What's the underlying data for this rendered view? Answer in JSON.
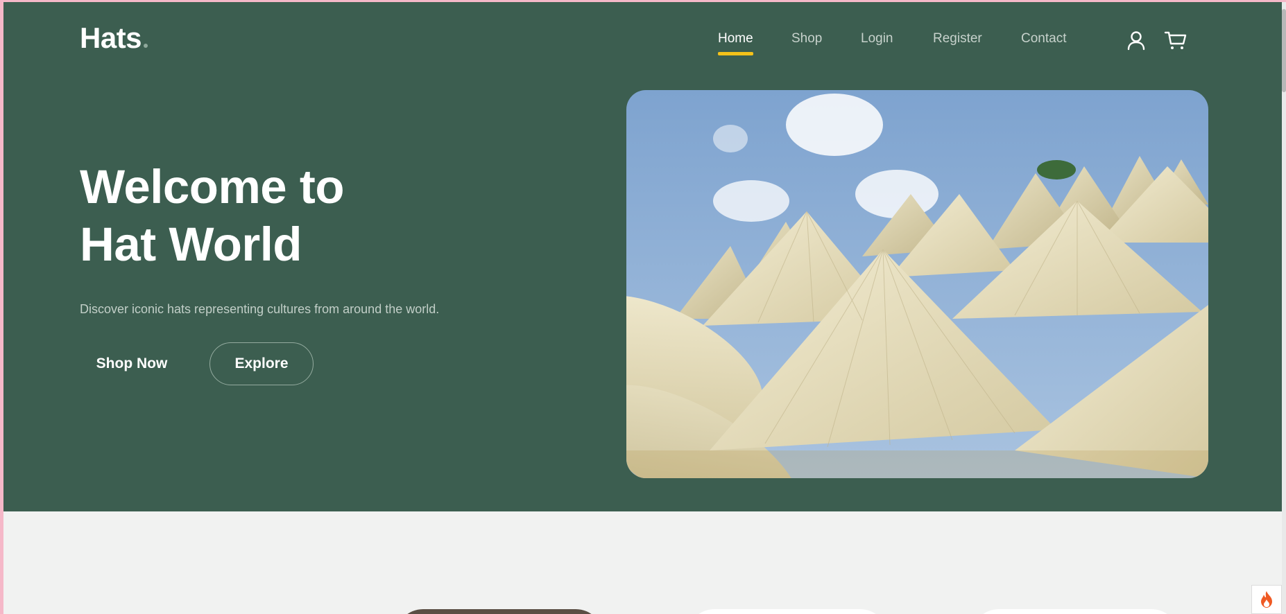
{
  "brand": {
    "name": "Hats",
    "accent": "#f4c21a",
    "hero_bg": "#3c5e50",
    "page_bg": "#f1f2f1"
  },
  "nav": {
    "items": [
      {
        "label": "Home",
        "active": true
      },
      {
        "label": "Shop",
        "active": false
      },
      {
        "label": "Login",
        "active": false
      },
      {
        "label": "Register",
        "active": false
      },
      {
        "label": "Contact",
        "active": false
      }
    ],
    "icons": [
      "user-icon",
      "cart-icon"
    ]
  },
  "hero": {
    "title_line1": "Welcome to",
    "title_line2": "Hat World",
    "subtitle": "Discover iconic hats representing cultures from around the world.",
    "primary_button": "Shop Now",
    "secondary_button": "Explore",
    "image_alt": "Vietnamese conical hats against a blue sky"
  },
  "widgets": {
    "flame": "flame-icon"
  }
}
